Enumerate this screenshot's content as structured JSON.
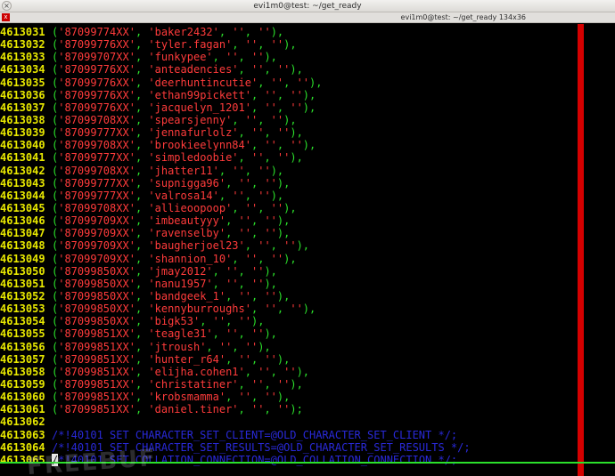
{
  "window": {
    "title": "evi1m0@test: ~/get_ready",
    "tab_title": "evi1m0@test: ~/get_ready 134x36",
    "close_glyph": "×",
    "tab_close_glyph": "x"
  },
  "watermark": "FREEBUF",
  "colors": {
    "line_number": "#e8e800",
    "string": "#ff3b3b",
    "punctuation": "#2be02b",
    "comment": "#2929d8",
    "margin_bar": "#d50000"
  },
  "terminal": {
    "rows": [
      {
        "ln": "4613031",
        "a": "'87099774XX'",
        "b": "'baker2432'",
        "c": "''",
        "d": "''",
        "end": "),"
      },
      {
        "ln": "4613032",
        "a": "'87099776XX'",
        "b": "'tyler.fagan'",
        "c": "''",
        "d": "''",
        "end": "),"
      },
      {
        "ln": "4613033",
        "a": "'87099707XX'",
        "b": "'funkypee'",
        "c": "''",
        "d": "''",
        "end": "),"
      },
      {
        "ln": "4613034",
        "a": "'87099776XX'",
        "b": "'anteadencies'",
        "c": "''",
        "d": "''",
        "end": "),"
      },
      {
        "ln": "4613035",
        "a": "'87099776XX'",
        "b": "'deerhuntincutie'",
        "c": "''",
        "d": "''",
        "end": "),"
      },
      {
        "ln": "4613036",
        "a": "'87099776XX'",
        "b": "'ethan99pickett'",
        "c": "''",
        "d": "''",
        "end": "),"
      },
      {
        "ln": "4613037",
        "a": "'87099776XX'",
        "b": "'jacquelyn_1201'",
        "c": "''",
        "d": "''",
        "end": "),"
      },
      {
        "ln": "4613038",
        "a": "'87099708XX'",
        "b": "'spearsjenny'",
        "c": "''",
        "d": "''",
        "end": "),"
      },
      {
        "ln": "4613039",
        "a": "'87099777XX'",
        "b": "'jennafurlolz'",
        "c": "''",
        "d": "''",
        "end": "),"
      },
      {
        "ln": "4613040",
        "a": "'87099708XX'",
        "b": "'brookieelynn84'",
        "c": "''",
        "d": "''",
        "end": "),"
      },
      {
        "ln": "4613041",
        "a": "'87099777XX'",
        "b": "'simpledoobie'",
        "c": "''",
        "d": "''",
        "end": "),"
      },
      {
        "ln": "4613042",
        "a": "'87099708XX'",
        "b": "'jhatter11'",
        "c": "''",
        "d": "''",
        "end": "),"
      },
      {
        "ln": "4613043",
        "a": "'87099777XX'",
        "b": "'supnigga96'",
        "c": "''",
        "d": "''",
        "end": "),"
      },
      {
        "ln": "4613044",
        "a": "'87099777XX'",
        "b": "'valrosa14'",
        "c": "''",
        "d": "''",
        "end": "),"
      },
      {
        "ln": "4613045",
        "a": "'87099708XX'",
        "b": "'allieoopoop'",
        "c": "''",
        "d": "''",
        "end": "),"
      },
      {
        "ln": "4613046",
        "a": "'87099709XX'",
        "b": "'imbeautyyy'",
        "c": "''",
        "d": "''",
        "end": "),"
      },
      {
        "ln": "4613047",
        "a": "'87099709XX'",
        "b": "'ravenselby'",
        "c": "''",
        "d": "''",
        "end": "),"
      },
      {
        "ln": "4613048",
        "a": "'87099709XX'",
        "b": "'baugherjoel23'",
        "c": "''",
        "d": "''",
        "end": "),"
      },
      {
        "ln": "4613049",
        "a": "'87099709XX'",
        "b": "'shannion_10'",
        "c": "''",
        "d": "''",
        "end": "),"
      },
      {
        "ln": "4613050",
        "a": "'87099850XX'",
        "b": "'jmay2012'",
        "c": "''",
        "d": "''",
        "end": "),"
      },
      {
        "ln": "4613051",
        "a": "'87099850XX'",
        "b": "'nanu1957'",
        "c": "''",
        "d": "''",
        "end": "),"
      },
      {
        "ln": "4613052",
        "a": "'87099850XX'",
        "b": "'bandgeek_1'",
        "c": "''",
        "d": "''",
        "end": "),"
      },
      {
        "ln": "4613053",
        "a": "'87099850XX'",
        "b": "'kennyburroughs'",
        "c": "''",
        "d": "''",
        "end": "),"
      },
      {
        "ln": "4613054",
        "a": "'87099850XX'",
        "b": "'bigk53'",
        "c": "''",
        "d": "''",
        "end": "),"
      },
      {
        "ln": "4613055",
        "a": "'87099851XX'",
        "b": "'teagle31'",
        "c": "''",
        "d": "''",
        "end": "),"
      },
      {
        "ln": "4613056",
        "a": "'87099851XX'",
        "b": "'jtroush'",
        "c": "''",
        "d": "''",
        "end": "),"
      },
      {
        "ln": "4613057",
        "a": "'87099851XX'",
        "b": "'hunter_r64'",
        "c": "''",
        "d": "''",
        "end": "),"
      },
      {
        "ln": "4613058",
        "a": "'87099851XX'",
        "b": "'elijha.cohen1'",
        "c": "''",
        "d": "''",
        "end": "),"
      },
      {
        "ln": "4613059",
        "a": "'87099851XX'",
        "b": "'christatiner'",
        "c": "''",
        "d": "''",
        "end": "),"
      },
      {
        "ln": "4613060",
        "a": "'87099851XX'",
        "b": "'krobsmamma'",
        "c": "''",
        "d": "''",
        "end": "),"
      },
      {
        "ln": "4613061",
        "a": "'87099851XX'",
        "b": "'daniel.tiner'",
        "c": "''",
        "d": "''",
        "end": ");"
      }
    ],
    "blank_line": {
      "ln": "4613062"
    },
    "comments": [
      {
        "ln": "4613063",
        "text": "/*!40101 SET CHARACTER_SET_CLIENT=@OLD_CHARACTER_SET_CLIENT */;"
      },
      {
        "ln": "4613064",
        "text": "/*!40101 SET CHARACTER_SET_RESULTS=@OLD_CHARACTER_SET_RESULTS */;"
      },
      {
        "ln": "4613065",
        "cursor": "/",
        "text": "*!40101 SET COLLATION_CONNECTION=@OLD_COLLATION_CONNECTION */;"
      }
    ]
  }
}
